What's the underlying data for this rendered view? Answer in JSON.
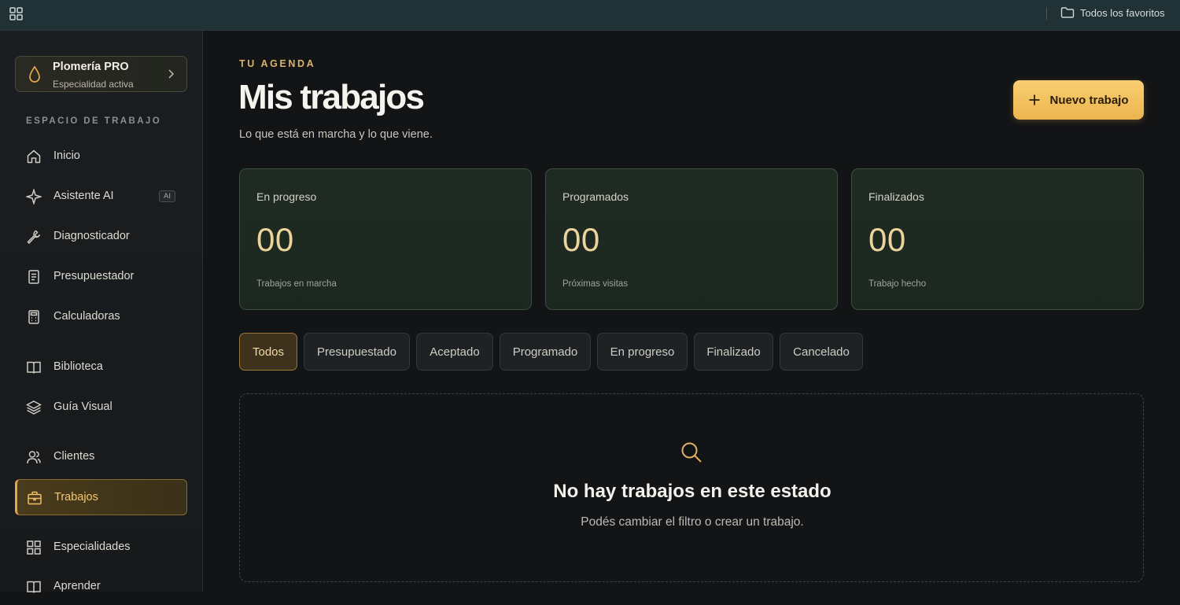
{
  "topbar": {
    "favorites_label": "Todos los favoritos"
  },
  "sidebar": {
    "specialty": {
      "name": "Plomería PRO",
      "status": "Especialidad activa"
    },
    "section_label": "ESPACIO DE TRABAJO",
    "items": [
      {
        "label": "Inicio",
        "icon": "home-icon"
      },
      {
        "label": "Asistente AI",
        "icon": "sparkle-icon",
        "badge": "AI"
      },
      {
        "label": "Diagnosticador",
        "icon": "wrench-icon"
      },
      {
        "label": "Presupuestador",
        "icon": "document-icon"
      },
      {
        "label": "Calculadoras",
        "icon": "calculator-icon"
      },
      {
        "label": "Biblioteca",
        "icon": "book-icon"
      },
      {
        "label": "Guía Visual",
        "icon": "layers-icon"
      },
      {
        "label": "Clientes",
        "icon": "users-icon"
      },
      {
        "label": "Trabajos",
        "icon": "briefcase-icon",
        "active": true
      },
      {
        "label": "Especialidades",
        "icon": "grid-icon"
      },
      {
        "label": "Aprender",
        "icon": "book-open-icon"
      }
    ]
  },
  "header": {
    "eyebrow": "TU AGENDA",
    "title": "Mis trabajos",
    "subtitle": "Lo que está en marcha y lo que viene.",
    "new_button_label": "Nuevo trabajo"
  },
  "stats": [
    {
      "label": "En progreso",
      "value": "00",
      "footer": "Trabajos en marcha"
    },
    {
      "label": "Programados",
      "value": "00",
      "footer": "Próximas visitas"
    },
    {
      "label": "Finalizados",
      "value": "00",
      "footer": "Trabajo hecho"
    }
  ],
  "filters": [
    {
      "label": "Todos",
      "active": true
    },
    {
      "label": "Presupuestado"
    },
    {
      "label": "Aceptado"
    },
    {
      "label": "Programado"
    },
    {
      "label": "En progreso"
    },
    {
      "label": "Finalizado"
    },
    {
      "label": "Cancelado"
    }
  ],
  "empty_state": {
    "title": "No hay trabajos en este estado",
    "subtitle": "Podés cambiar el filtro o crear un trabajo."
  },
  "colors": {
    "accent": "#edb44e",
    "card_bg": "#1f2b22",
    "topbar_bg": "#203236"
  }
}
